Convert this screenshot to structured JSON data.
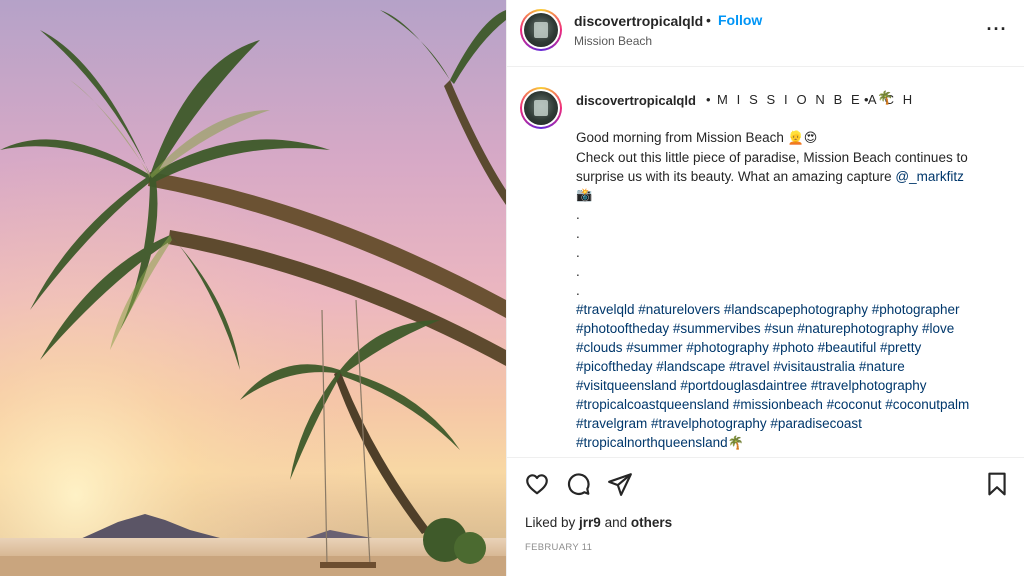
{
  "header": {
    "username": "discovertropicalqld",
    "separator": "•",
    "follow_label": "Follow",
    "location": "Mission Beach",
    "more_icon": "more-horizontal-icon",
    "more_glyph": "···"
  },
  "caption": {
    "username": "discovertropicalqld",
    "separator": "•",
    "location": "M I S S I O N B E A C H",
    "separator2": "•",
    "location_emoji": "🌴",
    "line1_text": "Good morning from Mission Beach ",
    "line1_emoji": "👱😍",
    "line2_text": "Check out this little piece of paradise, Mission Beach continues to",
    "line3_text": "surprise us with its beauty. What an amazing capture ",
    "mention": "@_markfitz",
    "camera_emoji": "📸",
    "dots": [
      ".",
      ".",
      ".",
      ".",
      "."
    ],
    "hashtag_lines": [
      "#travelqld #naturelovers #landscapephotography #photographer",
      "#photooftheday #summervibes #sun #naturephotography #love",
      "#clouds #summer #photography #photo #beautiful #pretty",
      "#picoftheday #landscape #travel #visitaustralia #nature",
      "#visitqueensland #portdouglasdaintree #travelphotography",
      "#tropicalcoastqueensland #missionbeach #coconut #coconutpalm",
      "#travelgram #travelphotography #paradisecoast"
    ],
    "last_hashtag": "#tropicalnorthqueensland",
    "last_emoji": "🌴"
  },
  "actions": {
    "icons": [
      "heart-icon",
      "comment-icon",
      "share-icon",
      "bookmark-icon"
    ],
    "liked_by_prefix": "Liked by ",
    "liked_by_user": "jrr9",
    "liked_by_and": " and ",
    "liked_by_others": "others",
    "date": "FEBRUARY 11"
  },
  "colors": {
    "link": "#00376b",
    "follow": "#0095f6",
    "text": "#262626",
    "secondary": "#8e8e8e"
  }
}
